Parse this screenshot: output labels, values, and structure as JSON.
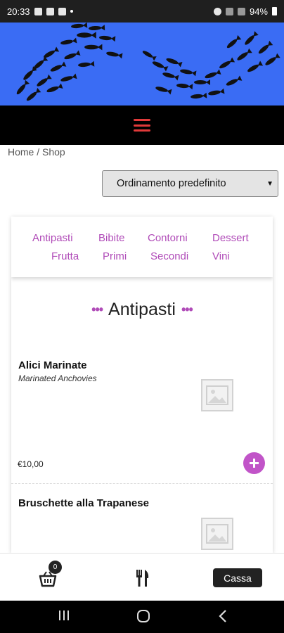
{
  "status_bar": {
    "time": "20:33",
    "battery": "94%"
  },
  "breadcrumb": {
    "text": "Home / Shop"
  },
  "sort": {
    "selected": "Ordinamento predefinito"
  },
  "categories": [
    "Antipasti",
    "Bibite",
    "Contorni",
    "Dessert",
    "Frutta",
    "Primi",
    "Secondi",
    "Vini"
  ],
  "section": {
    "title": "Antipasti"
  },
  "products": [
    {
      "name": "Alici Marinate",
      "subtitle": "Marinated Anchovies",
      "price": "€10,00"
    },
    {
      "name": "Bruschette alla Trapanese"
    }
  ],
  "cart": {
    "count": "0",
    "checkout_label": "Cassa"
  },
  "colors": {
    "accent": "#c154c8",
    "banner": "#3a6cf4",
    "hamburger": "#e03a3a"
  },
  "icons": [
    "hamburger-icon",
    "basket-icon",
    "fork-knife-icon",
    "plus-icon",
    "image-placeholder-icon"
  ]
}
